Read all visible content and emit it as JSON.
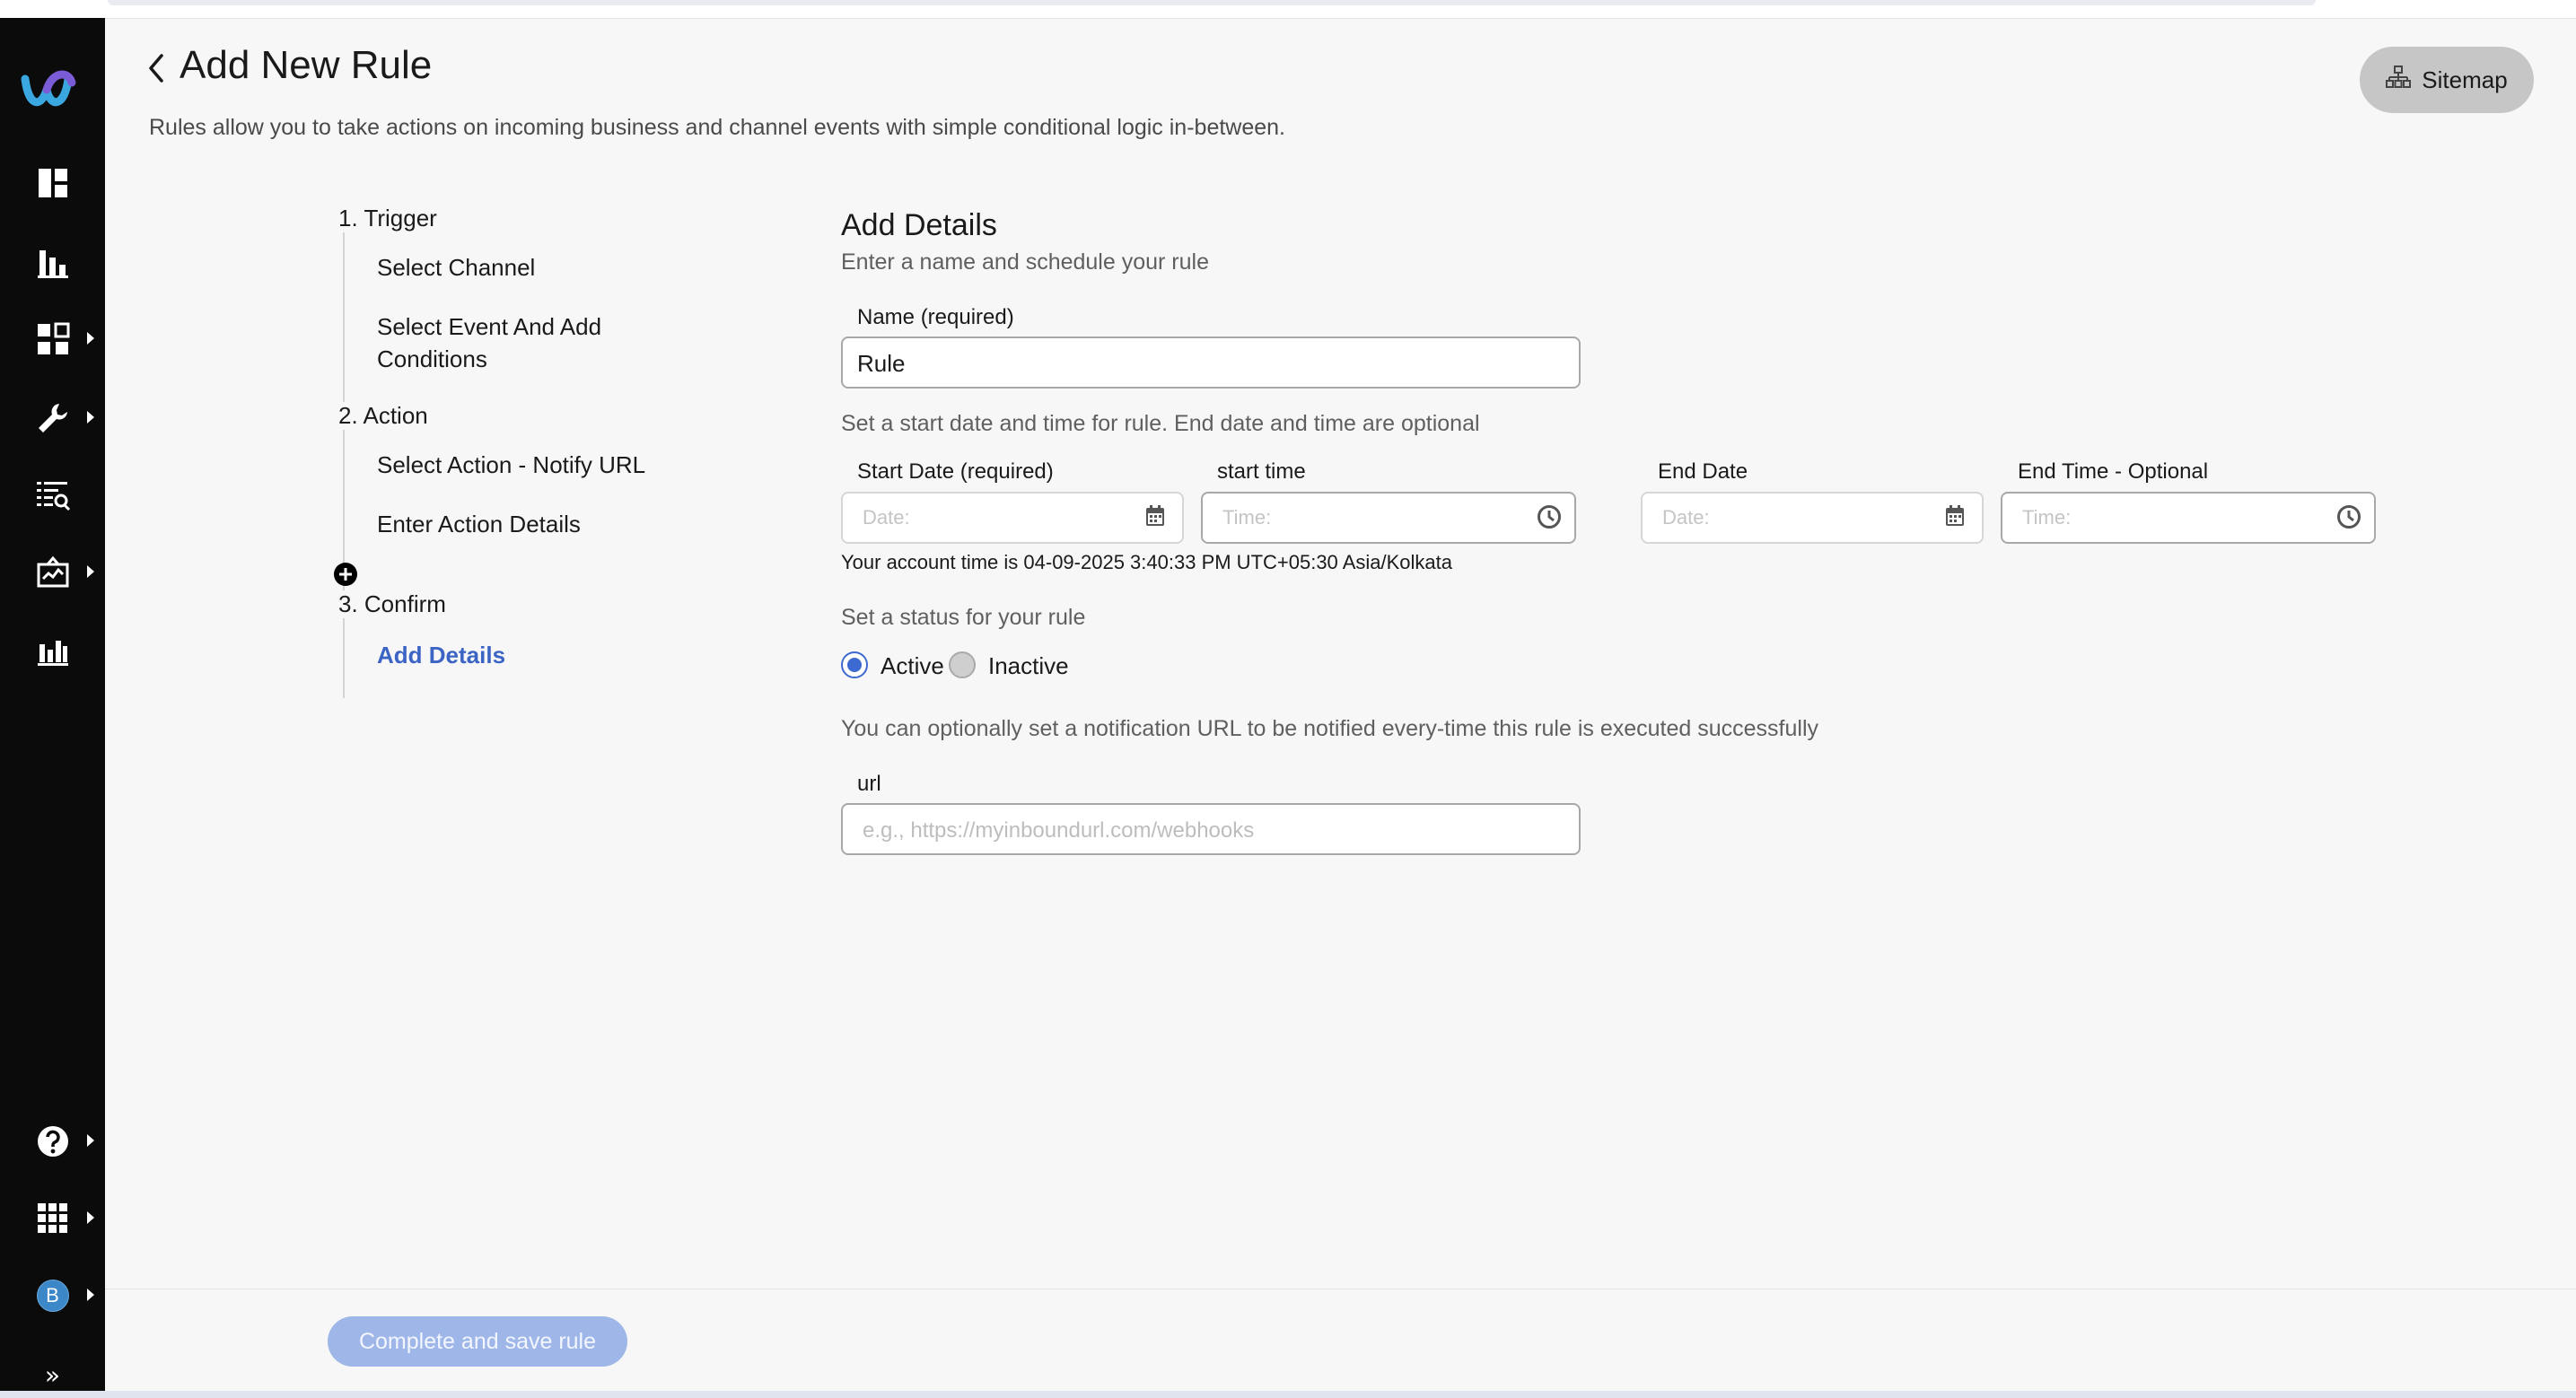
{
  "page": {
    "title": "Add New Rule",
    "description": "Rules allow you to take actions on incoming business and channel events with simple conditional logic in-between.",
    "sitemap_label": "Sitemap"
  },
  "steps": {
    "trigger": {
      "title": "1. Trigger",
      "items": [
        "Select Channel",
        "Select Event And Add",
        "Conditions"
      ]
    },
    "action": {
      "title": "2. Action",
      "items": [
        "Select Action - Notify URL",
        "Enter Action Details"
      ]
    },
    "confirm": {
      "title": "3. Confirm",
      "items": [
        "Add Details"
      ]
    }
  },
  "details": {
    "title": "Add Details",
    "subtitle": "Enter a name and schedule your rule",
    "name_label": "Name (required)",
    "name_value": "Rule",
    "schedule_hint": "Set a start date and time for rule. End date and time are optional",
    "start_date_label": "Start Date (required)",
    "start_time_label": "start time",
    "end_date_label": "End Date",
    "end_time_label": "End Time - Optional",
    "date_placeholder": "Date:",
    "time_placeholder": "Time:",
    "account_time": "Your account time is 04-09-2025 3:40:33 PM UTC+05:30 Asia/Kolkata",
    "status_hint": "Set a status for your rule",
    "status_active": "Active",
    "status_inactive": "Inactive",
    "status_selected": "Active",
    "notify_hint": "You can optionally set a notification URL to be notified every-time this rule is executed successfully",
    "url_label": "url",
    "url_placeholder": "e.g., https://myinboundurl.com/webhooks"
  },
  "footer": {
    "save_label": "Complete and save rule"
  },
  "sidebar": {
    "avatar_initial": "B",
    "collapse_glyph": "»",
    "icons": [
      "logo-icon",
      "dashboard-icon",
      "analytics-icon",
      "apps-icon",
      "wrench-icon",
      "reports-icon",
      "monitor-icon",
      "chart-icon",
      "help-icon",
      "app-grid-icon",
      "avatar",
      "collapse-icon"
    ]
  },
  "colors": {
    "sidebar_bg": "#0b0b0b",
    "accent": "#3d6ad1",
    "active_step": "#3b64c4",
    "save_button_disabled": "#9fb6e8"
  }
}
